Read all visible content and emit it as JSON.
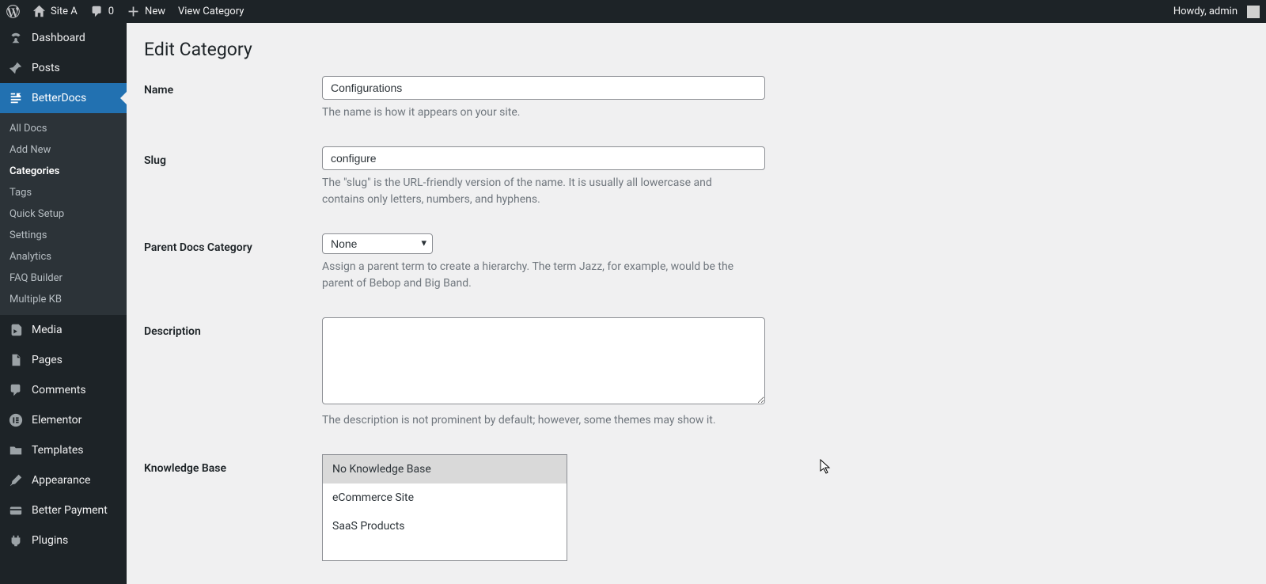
{
  "adminbar": {
    "site_name": "Site A",
    "comments_count": "0",
    "new_label": "New",
    "view_label": "View Category",
    "howdy": "Howdy, admin"
  },
  "sidebar": {
    "dashboard": "Dashboard",
    "posts": "Posts",
    "betterdocs": "BetterDocs",
    "submenu": {
      "all_docs": "All Docs",
      "add_new": "Add New",
      "categories": "Categories",
      "tags": "Tags",
      "quick_setup": "Quick Setup",
      "settings": "Settings",
      "analytics": "Analytics",
      "faq_builder": "FAQ Builder",
      "multiple_kb": "Multiple KB"
    },
    "media": "Media",
    "pages": "Pages",
    "comments": "Comments",
    "elementor": "Elementor",
    "templates": "Templates",
    "appearance": "Appearance",
    "better_payment": "Better Payment",
    "plugins": "Plugins"
  },
  "page": {
    "title": "Edit Category",
    "name": {
      "label": "Name",
      "value": "Configurations",
      "hint": "The name is how it appears on your site."
    },
    "slug": {
      "label": "Slug",
      "value": "configure",
      "hint": "The \"slug\" is the URL-friendly version of the name. It is usually all lowercase and contains only letters, numbers, and hyphens."
    },
    "parent": {
      "label": "Parent Docs Category",
      "value": "None",
      "hint": "Assign a parent term to create a hierarchy. The term Jazz, for example, would be the parent of Bebop and Big Band."
    },
    "description": {
      "label": "Description",
      "value": "",
      "hint": "The description is not prominent by default; however, some themes may show it."
    },
    "kb": {
      "label": "Knowledge Base",
      "options": [
        {
          "label": "No Knowledge Base",
          "selected": true
        },
        {
          "label": "eCommerce Site",
          "selected": false
        },
        {
          "label": "SaaS Products",
          "selected": false
        }
      ]
    }
  }
}
